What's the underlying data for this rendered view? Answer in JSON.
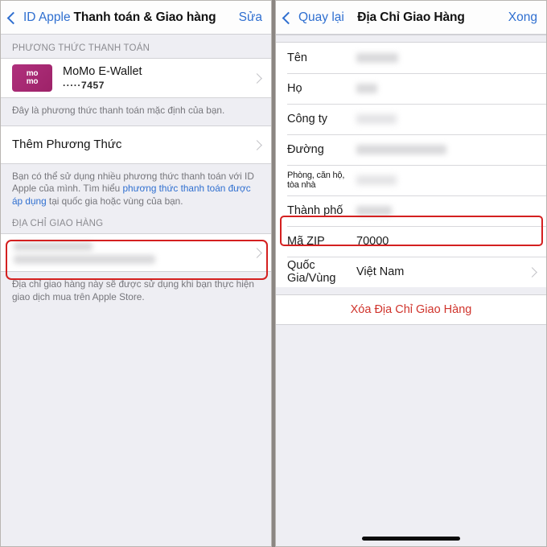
{
  "left_panel": {
    "navbar": {
      "back_label": "ID Apple",
      "title": "Thanh toán & Giao hàng",
      "action_label": "Sửa"
    },
    "payment_section": {
      "header": "PHƯƠNG THỨC THANH TOÁN",
      "method": {
        "logo_line1": "mo",
        "logo_line2": "mo",
        "name": "MoMo E-Wallet",
        "masked_number": "·····7457"
      },
      "footnote": "Đây là phương thức thanh toán mặc định của bạn.",
      "add_method_label": "Thêm Phương Thức",
      "info_prefix": "Bạn có thể sử dụng nhiều phương thức thanh toán với ID Apple của mình. Tìm hiểu ",
      "info_link": "phương thức thanh toán được áp dụng",
      "info_suffix": " tại quốc gia hoặc vùng của bạn."
    },
    "shipping_section": {
      "header": "ĐỊA CHỈ GIAO HÀNG",
      "address_value": "",
      "footnote": "Địa chỉ giao hàng này sẽ được sử dụng khi bạn thực hiện giao dịch mua trên Apple Store."
    }
  },
  "right_panel": {
    "navbar": {
      "back_label": "Quay lại",
      "title": "Địa Chỉ Giao Hàng",
      "action_label": "Xong"
    },
    "fields": [
      {
        "label": "Tên",
        "value": "",
        "redacted": true,
        "blur_width": 52
      },
      {
        "label": "Họ",
        "value": "",
        "redacted": true,
        "blur_width": 26
      },
      {
        "label": "Công ty",
        "value": "",
        "redacted": true,
        "blur_width": 50,
        "faint": true
      },
      {
        "label": "Đường",
        "value": "",
        "redacted": true,
        "blur_width": 112
      },
      {
        "label": "Phòng, căn hộ, tòa nhà",
        "value": "",
        "redacted": true,
        "blur_width": 50,
        "faint": true,
        "small_label": true
      },
      {
        "label": "Thành phố",
        "value": "",
        "redacted": true,
        "blur_width": 44
      },
      {
        "label": "Mã ZIP",
        "value": "70000",
        "redacted": false,
        "highlighted": true
      },
      {
        "label": "Quốc Gia/Vùng",
        "value": "Việt Nam",
        "redacted": false,
        "chevron": true
      }
    ],
    "delete_label": "Xóa Địa Chỉ Giao Hàng"
  },
  "colors": {
    "accent_blue": "#2f6fd0",
    "highlight_red": "#d42020",
    "destructive_red": "#d0342c",
    "momo_magenta": "#a42a72",
    "panel_background": "#eeeef3"
  }
}
